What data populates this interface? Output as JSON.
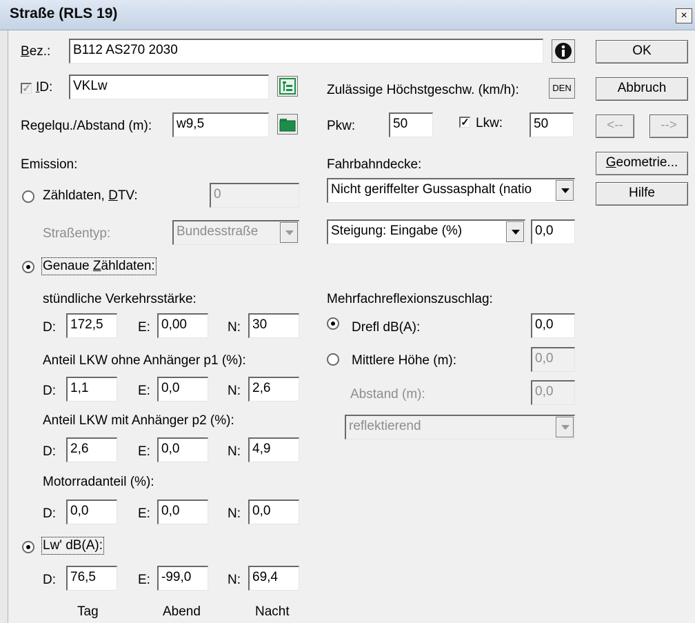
{
  "window": {
    "title": "Straße (RLS 19)",
    "close": "×"
  },
  "top": {
    "bez_label": "Bez.:",
    "bez_value": "B112 AS270 2030",
    "id_label": "ID:",
    "id_value": "VKLw",
    "regel_label": "Regelqu./Abstand (m):",
    "regel_value": "w9,5"
  },
  "speed": {
    "label": "Zulässige Höchstgeschw. (km/h):",
    "den_label": "DEN",
    "pkw_label": "Pkw:",
    "pkw_value": "50",
    "lkw_label": "Lkw:",
    "lkw_value": "50"
  },
  "emission": {
    "label": "Emission:",
    "zaehl_label": "Zähldaten, DTV:",
    "dtv_value": "0",
    "strassentyp_label": "Straßentyp:",
    "strassentyp_value": "Bundesstraße",
    "genau_label": "Genaue Zähldaten:",
    "verkehr_label": "stündliche Verkehrsstärke:",
    "p1_label": "Anteil LKW ohne Anhänger p1 (%):",
    "p2_label": "Anteil LKW mit Anhänger p2 (%):",
    "motor_label": "Motorradanteil (%):",
    "lw_label": "Lw' dB(A):",
    "d": "D:",
    "e": "E:",
    "n": "N:",
    "verkehr": {
      "d": "172,5",
      "e": "0,00",
      "n": "30"
    },
    "p1": {
      "d": "1,1",
      "e": "0,0",
      "n": "2,6"
    },
    "p2": {
      "d": "2,6",
      "e": "0,0",
      "n": "4,9"
    },
    "motor": {
      "d": "0,0",
      "e": "0,0",
      "n": "0,0"
    },
    "lw": {
      "d": "76,5",
      "e": "-99,0",
      "n": "69,4"
    },
    "col_tag": "Tag",
    "col_abend": "Abend",
    "col_nacht": "Nacht"
  },
  "fahrbahn": {
    "label": "Fahrbahndecke:",
    "value": "Nicht geriffelter Gussasphalt (natio",
    "steigung_value": "Steigung: Eingabe (%)",
    "steigung_num": "0,0"
  },
  "reflex": {
    "label": "Mehrfachreflexionszuschlag:",
    "drefl_label": "Drefl dB(A):",
    "drefl_value": "0,0",
    "hoehe_label": "Mittlere Höhe (m):",
    "hoehe_value": "0,0",
    "abstand_label": "Abstand (m):",
    "abstand_value": "0,0",
    "typ_value": "reflektierend"
  },
  "buttons": {
    "ok": "OK",
    "abbruch": "Abbruch",
    "prev": "<--",
    "next": "-->",
    "geometrie": "Geometrie...",
    "hilfe": "Hilfe"
  },
  "colors": {
    "titlebar": "#c4d3e6",
    "dialog_bg": "#f0f0f0",
    "folder_icon": "#1b8f4a"
  }
}
